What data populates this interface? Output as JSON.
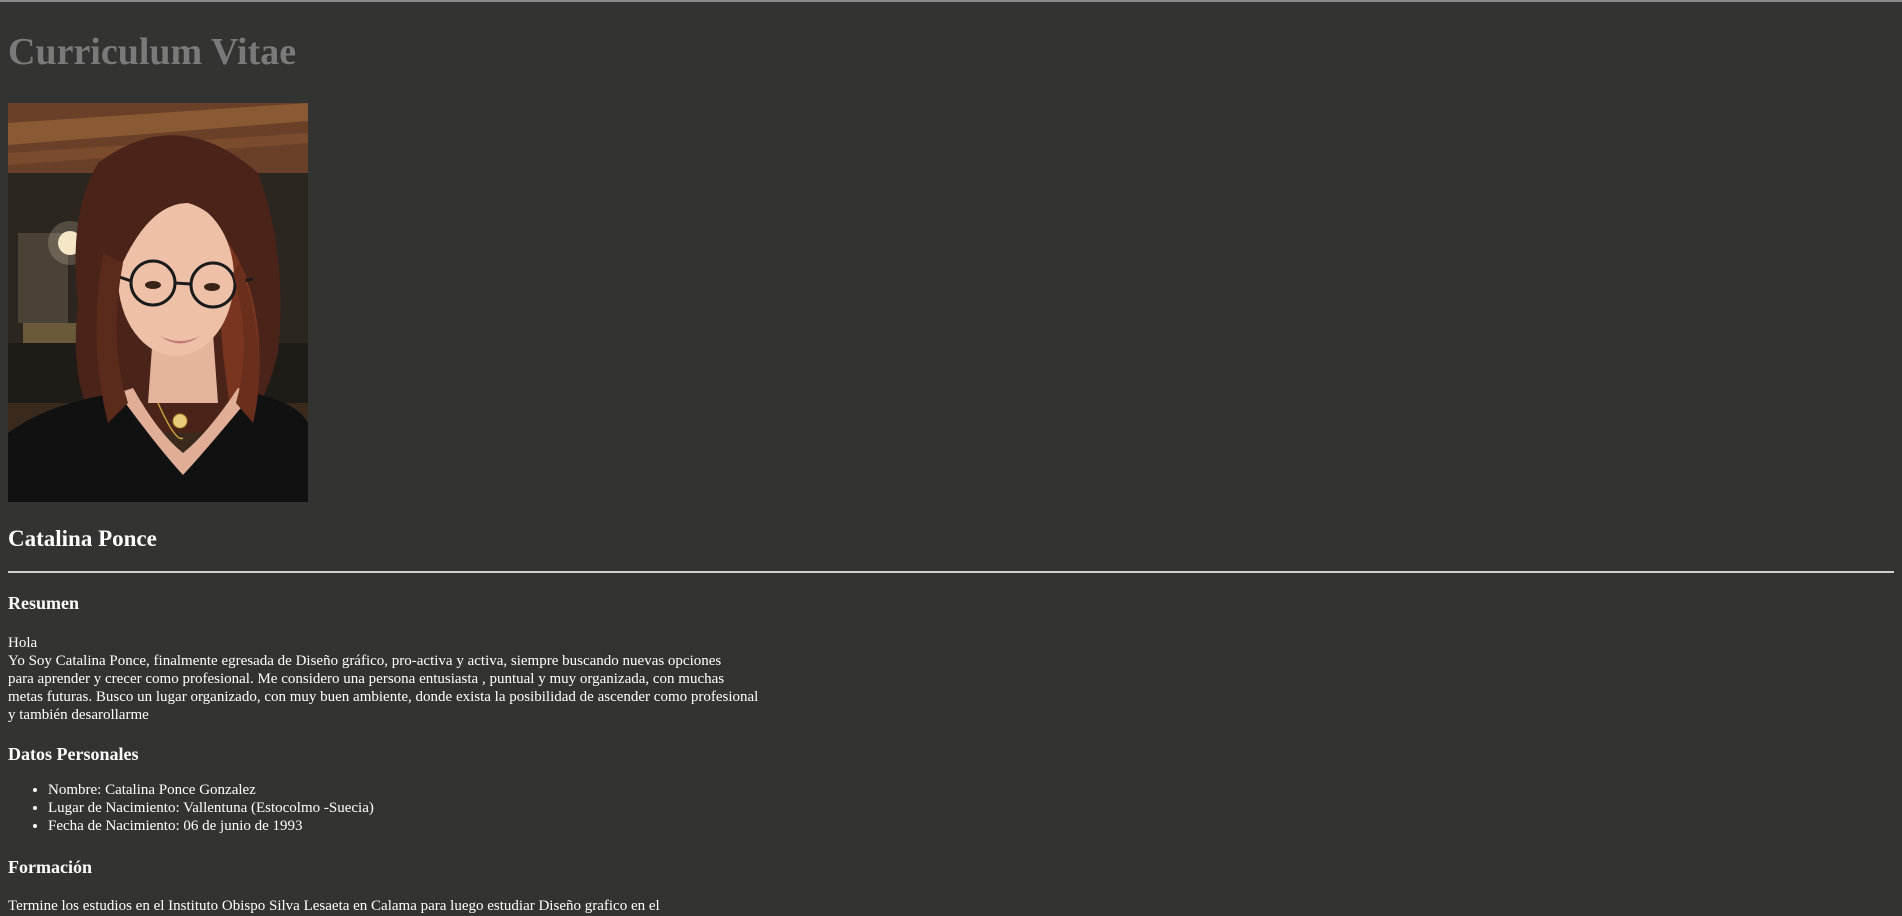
{
  "page": {
    "title": "Curriculum Vitae",
    "name": "Catalina Ponce"
  },
  "photo": {
    "icon": "portrait-photo"
  },
  "resumen": {
    "heading": "Resumen",
    "lines": [
      "Hola",
      "Yo Soy Catalina Ponce, finalmente egresada de Diseño gráfico, pro-activa y activa, siempre buscando nuevas opciones",
      "para aprender y crecer como profesional. Me considero una persona entusiasta , puntual y muy organizada, con muchas",
      "metas futuras. Busco un lugar organizado, con muy buen ambiente, donde exista la posibilidad de ascender como profesional",
      "y también desarollarme"
    ]
  },
  "datos": {
    "heading": "Datos Personales",
    "items": [
      "Nombre: Catalina Ponce Gonzalez",
      "Lugar de Nacimiento: Vallentuna (Estocolmo -Suecia)",
      "Fecha de Nacimiento: 06 de junio de 1993"
    ]
  },
  "formacion": {
    "heading": "Formación",
    "text": "Termine los estudios en el Instituto Obispo Silva Lesaeta en Calama para luego estudiar Diseño grafico en el"
  },
  "colors": {
    "background": "#333432",
    "title": "#7a7a7a",
    "text": "#ffffff"
  }
}
